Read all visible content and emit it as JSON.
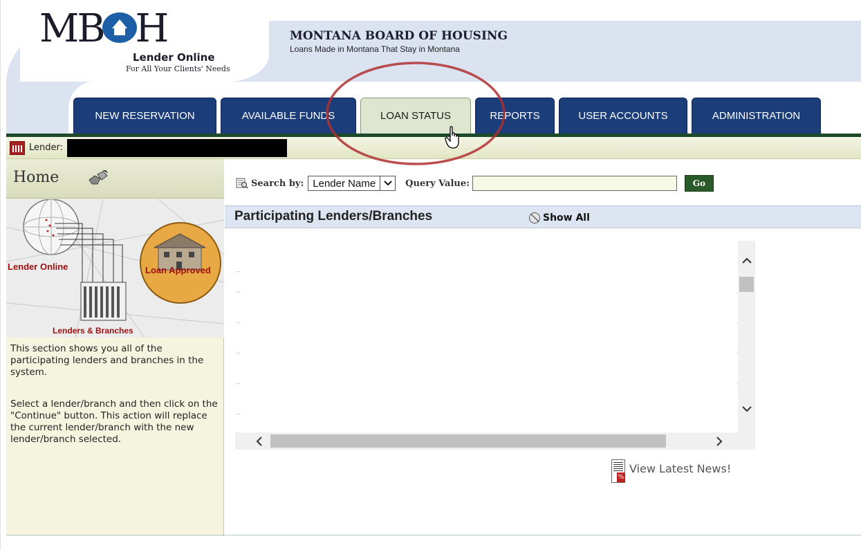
{
  "header": {
    "logo_text_left": "MB",
    "logo_text_right": "H",
    "lender_online_title": "Lender Online",
    "lender_online_subtitle": "For All Your Clients' Needs",
    "org_title": "MONTANA BOARD OF HOUSING",
    "org_tagline": "Loans Made in Montana That Stay in Montana"
  },
  "tabs": [
    {
      "label": "NEW RESERVATION",
      "active": false
    },
    {
      "label": "AVAILABLE FUNDS",
      "active": false
    },
    {
      "label": "LOAN STATUS",
      "active": true
    },
    {
      "label": "REPORTS",
      "active": false
    },
    {
      "label": "USER ACCOUNTS",
      "active": false
    },
    {
      "label": "ADMINISTRATION",
      "active": false
    }
  ],
  "lender_bar": {
    "label": "Lender:",
    "value_redacted": true
  },
  "sidebar": {
    "home_label": "Home",
    "illustration": {
      "lender_online": "Lender Online",
      "loan_approved": "Loan Approved",
      "lenders_branches": "Lenders & Branches"
    },
    "paragraph_1": "This section shows you all of the participating lenders and branches in the system.",
    "paragraph_2": "Select a lender/branch and then click on the \"Continue\" button. This action will replace the current lender/branch with the new lender/branch selected."
  },
  "search": {
    "label": "Search by:",
    "selected_option": "Lender Name",
    "query_label": "Query Value:",
    "query_value": "",
    "go_label": "Go"
  },
  "section": {
    "title": "Participating Lenders/Branches",
    "show_all_label": "Show All"
  },
  "news": {
    "label": "View Latest News!"
  },
  "colors": {
    "tab_blue": "#1b3e7a",
    "tab_active": "#dfe6cf",
    "header_band": "#dbe3f1",
    "annotation_ellipse": "#b03030",
    "go_button": "#2a5a2a"
  },
  "icons": {
    "lender_bar": "bank-icon",
    "home": "home-handshake-icon",
    "search": "search-binoculars-icon",
    "show_all": "show-all-icon",
    "news": "news-document-icon"
  }
}
